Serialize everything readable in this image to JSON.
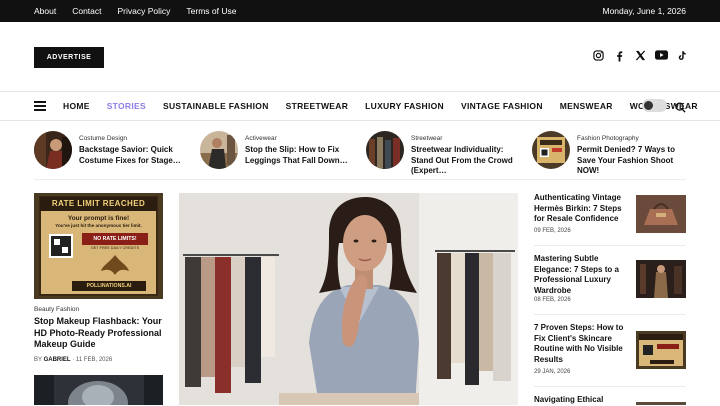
{
  "topbar": {
    "links": [
      "About",
      "Contact",
      "Privacy Policy",
      "Terms of Use"
    ],
    "date": "Monday, June 1, 2026"
  },
  "header": {
    "advertise_label": "ADVERTISE",
    "social_icons": [
      "instagram-icon",
      "facebook-icon",
      "x-icon",
      "youtube-icon",
      "tiktok-icon"
    ]
  },
  "nav": {
    "items": [
      "HOME",
      "STORIES",
      "SUSTAINABLE FASHION",
      "STREETWEAR",
      "LUXURY FASHION",
      "VINTAGE FASHION",
      "MENSWEAR",
      "WOMENSWEAR"
    ],
    "active_index": 1,
    "accent_color": "#8c7ee8"
  },
  "trending": [
    {
      "category": "Costume Design",
      "title": "Backstage Savior: Quick Costume Fixes for Stage…"
    },
    {
      "category": "Activewear",
      "title": "Stop the Slip: How to Fix Leggings That Fall Down…"
    },
    {
      "category": "Streetwear",
      "title": "Streetwear Individuality: Stand Out From the Crowd (Expert…"
    },
    {
      "category": "Fashion Photography",
      "title": "Permit Denied? 7 Ways to Save Your Fashion Shoot NOW!"
    }
  ],
  "left_card": {
    "image_text": {
      "headline": "RATE LIMIT REACHED",
      "line1": "Your prompt is fine!",
      "line2": "You've just hit the anonymous tier limit.",
      "badge": "NO RATE LIMITS!",
      "badge_sub": "GET FREE DAILY CREDITS",
      "brand": "POLLINATIONS.AI"
    },
    "category": "Beauty Fashion",
    "title": "Stop Makeup Flashback: Your HD Photo-Ready Professional Makeup Guide",
    "author_prefix": "BY",
    "author": "GABRIEL",
    "date": "11 FEB, 2026"
  },
  "side_list": [
    {
      "title": "Authenticating Vintage Hermès Birkin: 7 Steps for Resale Confidence",
      "date": "09 FEB, 2026"
    },
    {
      "title": "Mastering Subtle Elegance: 7 Steps to a Professional Luxury Wardrobe",
      "date": "08 FEB, 2026"
    },
    {
      "title": "7 Proven Steps: How to Fix Client's Skincare Routine with No Visible Results",
      "date": "29 JAN, 2026"
    },
    {
      "title": "Navigating Ethical",
      "date": ""
    }
  ]
}
